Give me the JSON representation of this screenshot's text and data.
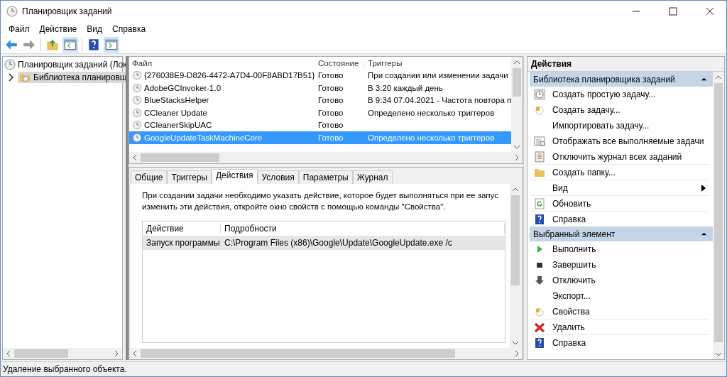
{
  "window": {
    "title": "Планировщик заданий"
  },
  "menu": [
    "Файл",
    "Действие",
    "Вид",
    "Справка"
  ],
  "tree": {
    "label": "Планировщик заданий (Лок",
    "children": [
      {
        "label": "Библиотека планировщ",
        "expanded": false,
        "selected": true
      }
    ]
  },
  "tasks": {
    "columns": [
      "Файл",
      "Состояние",
      "Триггеры"
    ],
    "rows": [
      {
        "file": "{276038E9-D826-4472-A7D4-00F8ABD17B51}",
        "status": "Готово",
        "triggers": "При создании или изменении задачи",
        "selected": false
      },
      {
        "file": "AdobeGCInvoker-1.0",
        "status": "Готово",
        "triggers": "В 3:20 каждый день",
        "selected": false
      },
      {
        "file": "BlueStacksHelper",
        "status": "Готово",
        "triggers": "В 9:34 07.04.2021 - Частота повтора п",
        "selected": false
      },
      {
        "file": "CCleaner Update",
        "status": "Готово",
        "triggers": "Определено несколько триггеров",
        "selected": false
      },
      {
        "file": "CCleanerSkipUAC",
        "status": "Готово",
        "triggers": "",
        "selected": false
      },
      {
        "file": "GoogleUpdateTaskMachineCore",
        "status": "Готово",
        "triggers": "Определено несколько триггеров",
        "selected": true
      }
    ]
  },
  "tabs": [
    {
      "label": "Общие",
      "selected": false
    },
    {
      "label": "Триггеры",
      "selected": false
    },
    {
      "label": "Действия",
      "selected": true
    },
    {
      "label": "Условия",
      "selected": false
    },
    {
      "label": "Параметры",
      "selected": false
    },
    {
      "label": "Журнал",
      "selected": false
    }
  ],
  "description": "При создании задачи необходимо указать действие, которое будет выполняться при ее запус изменить эти действия, откройте окно свойств с помощью команды \"Свойства\".",
  "action_table": {
    "columns": [
      "Действие",
      "Подробности"
    ],
    "rows": [
      [
        "Запуск программы",
        "C:\\Program Files (x86)\\Google\\Update\\GoogleUpdate.exe /c"
      ]
    ]
  },
  "actions": {
    "title": "Действия",
    "sections": [
      {
        "title": "Библиотека планировщика заданий",
        "expanded": true,
        "items": [
          {
            "label": "Создать простую задачу...",
            "kind": "wizard",
            "divider": false,
            "submenu": false
          },
          {
            "label": "Создать задачу...",
            "kind": "clock",
            "divider": false,
            "submenu": false
          },
          {
            "label": "Импортировать задачу...",
            "kind": "none",
            "divider": false,
            "submenu": false
          },
          {
            "label": "Отображать все выполняемые задачи",
            "kind": "list",
            "divider": false,
            "submenu": false
          },
          {
            "label": "Отключить журнал всех заданий",
            "kind": "log",
            "divider": false,
            "submenu": false
          },
          {
            "label": "Создать папку...",
            "kind": "folder",
            "divider": true,
            "submenu": false
          },
          {
            "label": "Вид",
            "kind": "none",
            "divider": true,
            "submenu": true
          },
          {
            "label": "Обновить",
            "kind": "refresh",
            "divider": true,
            "submenu": false
          },
          {
            "label": "Справка",
            "kind": "help",
            "divider": true,
            "submenu": false
          }
        ]
      },
      {
        "title": "Выбранный элемент",
        "expanded": true,
        "items": [
          {
            "label": "Выполнить",
            "kind": "run",
            "divider": false,
            "submenu": false
          },
          {
            "label": "Завершить",
            "kind": "stop",
            "divider": false,
            "submenu": false
          },
          {
            "label": "Отключить",
            "kind": "down",
            "divider": false,
            "submenu": false
          },
          {
            "label": "Экспорт...",
            "kind": "none",
            "divider": false,
            "submenu": false
          },
          {
            "label": "Свойства",
            "kind": "clock",
            "divider": false,
            "submenu": false
          },
          {
            "label": "Удалить",
            "kind": "delete",
            "divider": true,
            "submenu": false
          },
          {
            "label": "Справка",
            "kind": "help",
            "divider": true,
            "submenu": false
          }
        ]
      }
    ]
  },
  "status_bar": "Удаление выбранного объекта."
}
